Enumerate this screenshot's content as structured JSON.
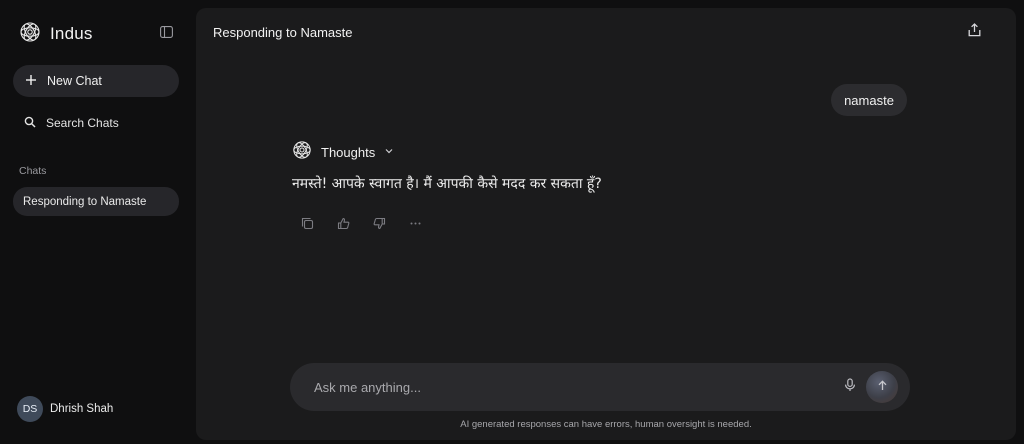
{
  "sidebar": {
    "brand": "Indus",
    "new_chat_label": "New Chat",
    "search_label": "Search Chats",
    "chats_heading": "Chats",
    "chats": [
      {
        "label": "Responding to Namaste"
      }
    ],
    "user": {
      "initials": "DS",
      "name": "Dhrish Shah"
    }
  },
  "main": {
    "title": "Responding to Namaste",
    "user_message": "namaste",
    "thoughts_label": "Thoughts",
    "answer": "नमस्ते! आपके स्वागत है। मैं आपकी कैसे मदद कर सकता हूँ?",
    "composer": {
      "placeholder": "Ask me anything..."
    },
    "disclaimer": "AI generated responses can have errors, human oversight is needed."
  },
  "icons": {
    "logo": "indus-logo-icon",
    "collapse": "sidebar-toggle-icon",
    "new_chat": "plus-icon",
    "search": "search-icon",
    "share": "share-icon",
    "thoughts": "indus-logo-icon",
    "chevron": "chevron-down-icon",
    "copy": "copy-icon",
    "like": "thumbs-up-icon",
    "dislike": "thumbs-down-icon",
    "more": "more-icon",
    "mic": "microphone-icon",
    "send": "arrow-up-icon"
  },
  "colors": {
    "background": "#0f0f10",
    "panel": "#1b1b1c",
    "bubble": "#2c2c2f",
    "accent_chip": "#26262a"
  }
}
